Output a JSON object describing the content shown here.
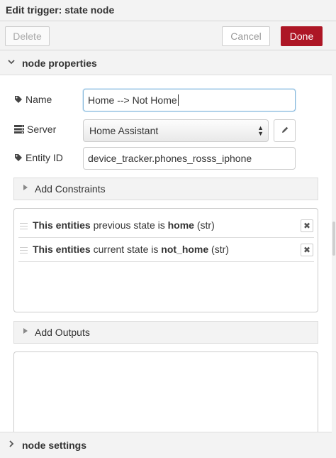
{
  "dialog": {
    "title": "Edit trigger: state node"
  },
  "toolbar": {
    "delete_label": "Delete",
    "cancel_label": "Cancel",
    "done_label": "Done"
  },
  "sections": {
    "node_properties": "node properties",
    "node_settings": "node settings"
  },
  "form": {
    "name_label": "Name",
    "name_value": "Home --> Not Home",
    "server_label": "Server",
    "server_value": "Home Assistant",
    "entity_label": "Entity ID",
    "entity_value": "device_tracker.phones_rosss_iphone"
  },
  "constraints": {
    "header": "Add Constraints",
    "items": [
      {
        "subject": "This entities",
        "mid": " previous state is ",
        "value": "home",
        "type": " (str)"
      },
      {
        "subject": "This entities",
        "mid": " current state is ",
        "value": "not_home",
        "type": " (str)"
      }
    ],
    "delete_glyph": "✖"
  },
  "outputs": {
    "header": "Add Outputs"
  },
  "colors": {
    "accent": "#ad1625",
    "focus": "#85b7d9",
    "panel_bg": "#ffffff",
    "chrome_bg": "#f3f3f3"
  },
  "icons": [
    "tag-icon",
    "server-icon",
    "pencil-icon",
    "chevron-down-icon",
    "chevron-right-icon",
    "drag-handle-icon",
    "remove-icon",
    "select-arrows-icon"
  ]
}
